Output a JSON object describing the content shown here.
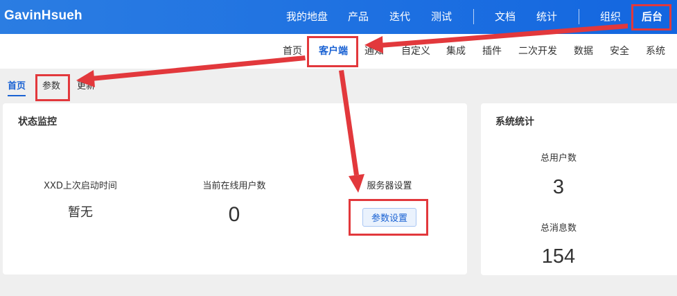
{
  "header": {
    "brand": "GavinHsueh",
    "nav": [
      "我的地盘",
      "产品",
      "迭代",
      "测试",
      "文档",
      "统计",
      "组织",
      "后台"
    ],
    "active": "后台"
  },
  "subnav": {
    "items": [
      "首页",
      "客户端",
      "通知",
      "自定义",
      "集成",
      "插件",
      "二次开发",
      "数据",
      "安全",
      "系统"
    ],
    "active": "客户端"
  },
  "tabs": {
    "items": [
      "首页",
      "参数",
      "更新"
    ],
    "active": "首页"
  },
  "status_card": {
    "title": "状态监控",
    "xxd_label": "XXD上次启动时间",
    "xxd_value": "暂无",
    "online_label": "当前在线用户数",
    "online_value": "0",
    "server_label": "服务器设置",
    "server_button": "参数设置"
  },
  "stats_card": {
    "title": "系统统计",
    "users_label": "总用户数",
    "users_value": "3",
    "messages_label": "总消息数",
    "messages_value": "154"
  },
  "colors": {
    "header_bg": "#1a6fe0",
    "accent": "#1a62d3",
    "annotation": "#e2383c"
  }
}
